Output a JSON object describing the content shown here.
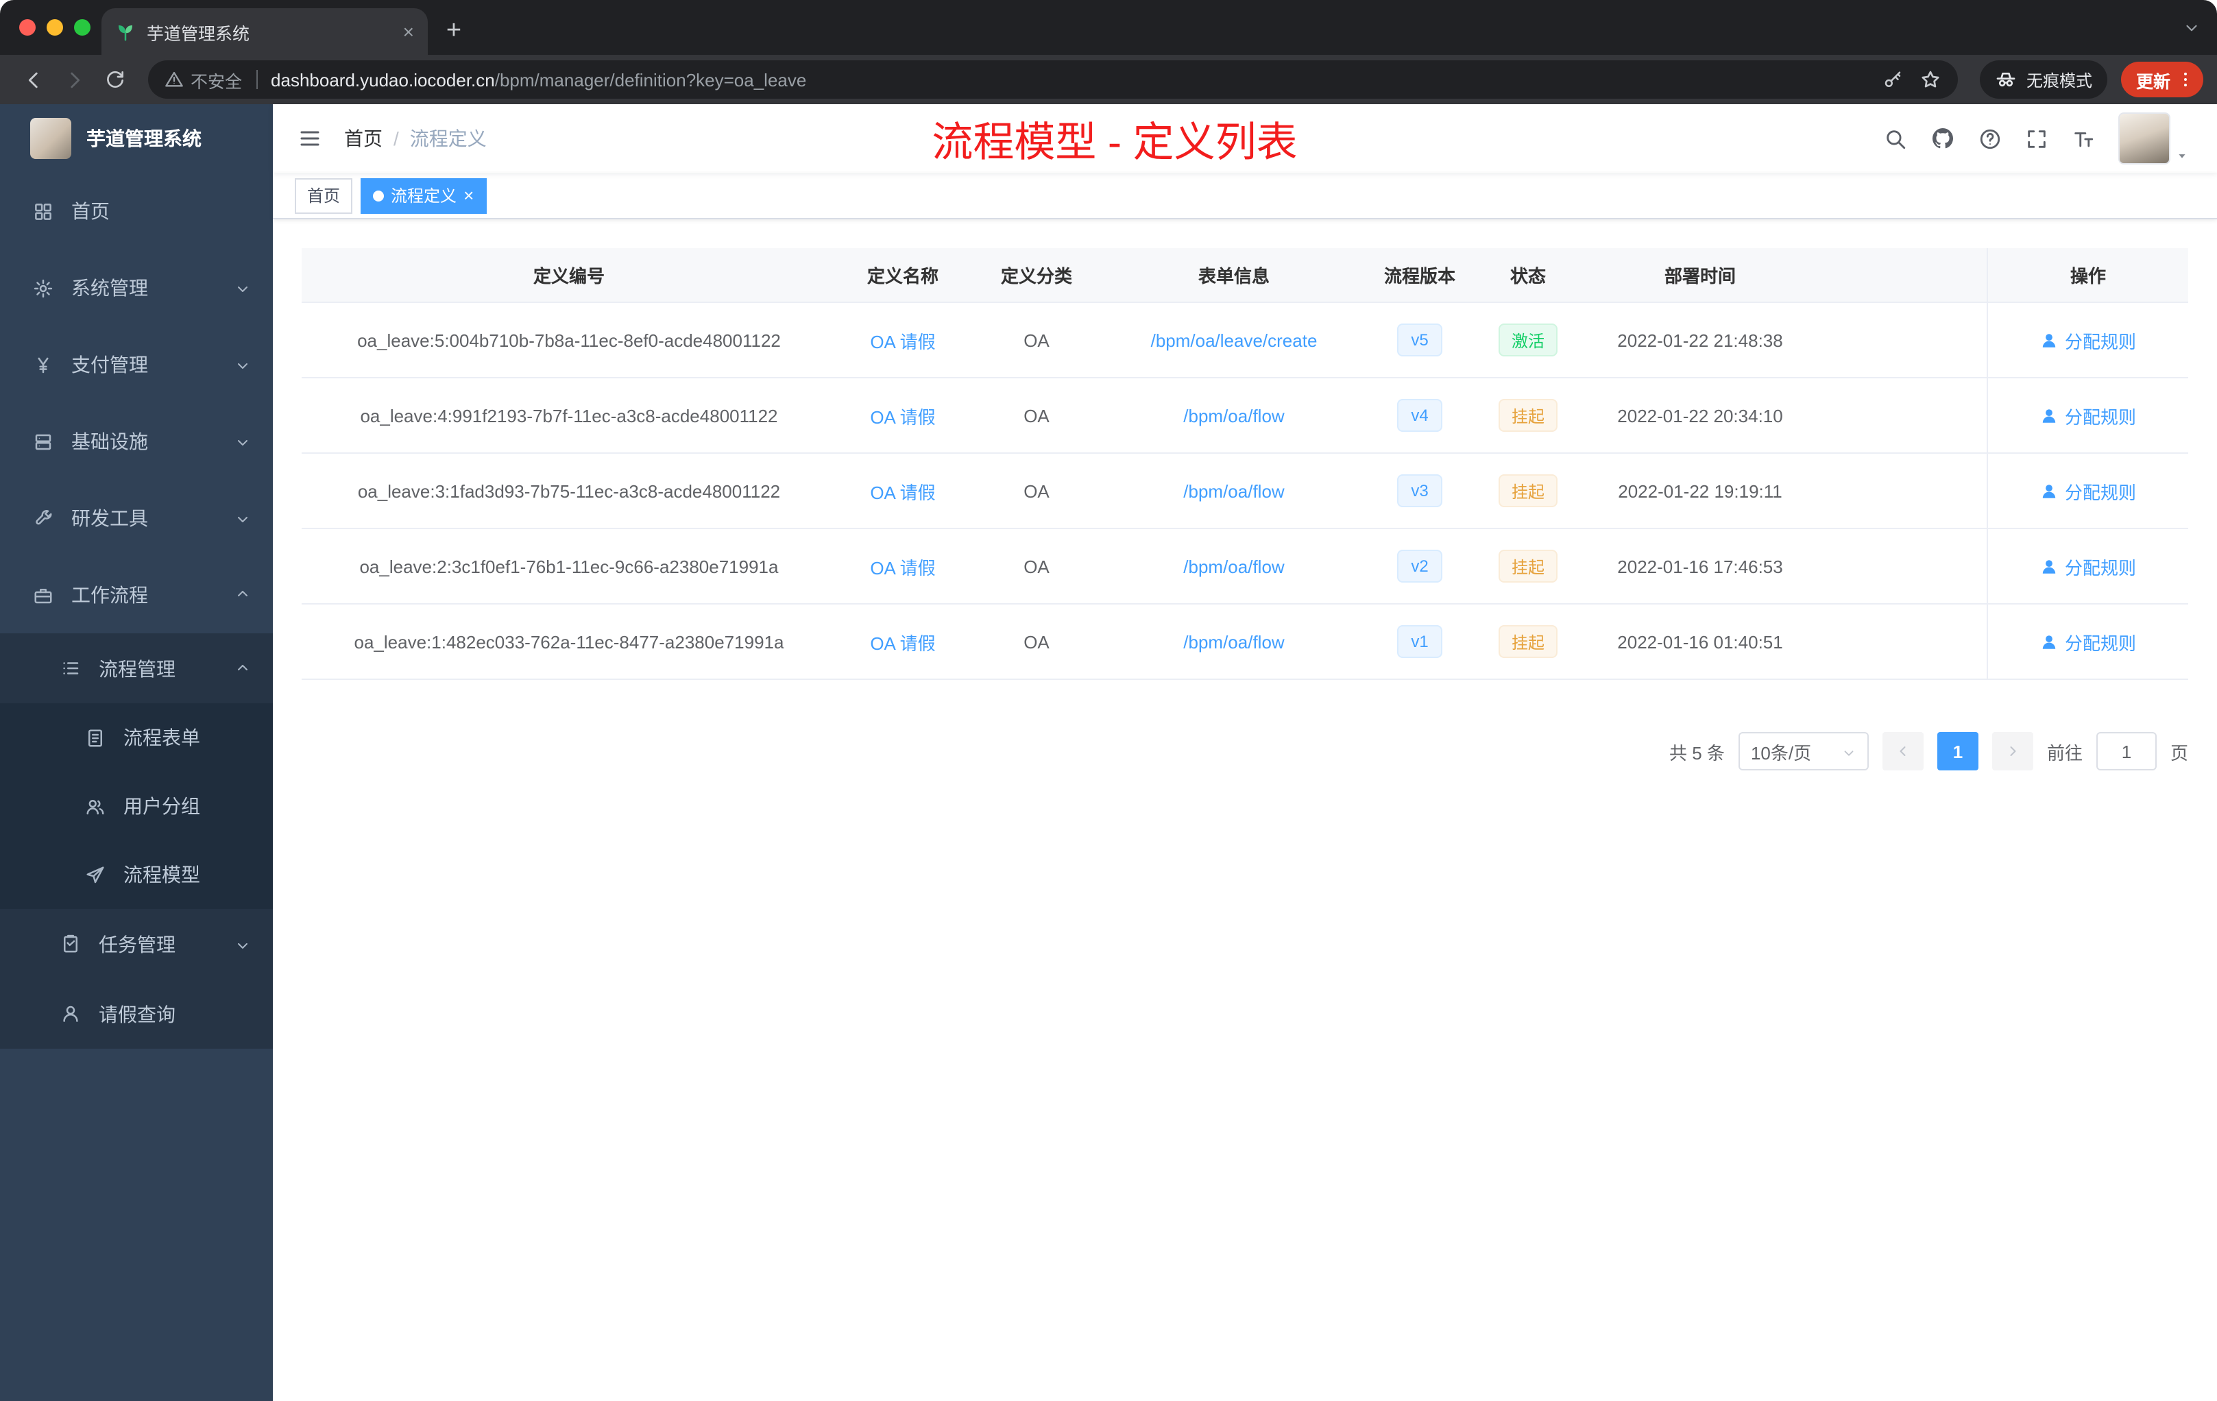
{
  "browser": {
    "tab_title": "芋道管理系统",
    "new_tab_label": "+",
    "security_label": "不安全",
    "url_host": "dashboard.yudao.iocoder.cn",
    "url_path": "/bpm/manager/definition?key=oa_leave",
    "incognito_label": "无痕模式",
    "update_label": "更新",
    "close_tab_label": "×"
  },
  "sidebar": {
    "logo_title": "芋道管理系统",
    "items": [
      {
        "label": "首页",
        "icon": "dashboard-icon"
      },
      {
        "label": "系统管理",
        "icon": "gear-icon",
        "expanded": false
      },
      {
        "label": "支付管理",
        "icon": "yen-icon",
        "expanded": false
      },
      {
        "label": "基础设施",
        "icon": "server-icon",
        "expanded": false
      },
      {
        "label": "研发工具",
        "icon": "wrench-icon",
        "expanded": false
      },
      {
        "label": "工作流程",
        "icon": "briefcase-icon",
        "expanded": true
      },
      {
        "label": "流程管理",
        "icon": "list-icon",
        "expanded": true
      },
      {
        "label": "流程表单",
        "icon": "document-icon"
      },
      {
        "label": "用户分组",
        "icon": "users-icon"
      },
      {
        "label": "流程模型",
        "icon": "paper-plane-icon"
      },
      {
        "label": "任务管理",
        "icon": "clipboard-icon",
        "expanded": false
      },
      {
        "label": "请假查询",
        "icon": "user-icon"
      }
    ]
  },
  "header": {
    "breadcrumb": {
      "home": "首页",
      "separator": "/",
      "current": "流程定义"
    },
    "annotation": "流程模型 - 定义列表"
  },
  "tags": {
    "home": "首页",
    "current": "流程定义",
    "close": "×"
  },
  "table": {
    "columns": [
      "定义编号",
      "定义名称",
      "定义分类",
      "表单信息",
      "流程版本",
      "状态",
      "部署时间",
      "操作"
    ],
    "rows": [
      {
        "id": "oa_leave:5:004b710b-7b8a-11ec-8ef0-acde48001122",
        "name": "OA 请假",
        "category": "OA",
        "form": "/bpm/oa/leave/create",
        "version": "v5",
        "status": "激活",
        "status_type": "success",
        "deploy_time": "2022-01-22 21:48:38",
        "action": "分配规则"
      },
      {
        "id": "oa_leave:4:991f2193-7b7f-11ec-a3c8-acde48001122",
        "name": "OA 请假",
        "category": "OA",
        "form": "/bpm/oa/flow",
        "version": "v4",
        "status": "挂起",
        "status_type": "warning",
        "deploy_time": "2022-01-22 20:34:10",
        "action": "分配规则"
      },
      {
        "id": "oa_leave:3:1fad3d93-7b75-11ec-a3c8-acde48001122",
        "name": "OA 请假",
        "category": "OA",
        "form": "/bpm/oa/flow",
        "version": "v3",
        "status": "挂起",
        "status_type": "warning",
        "deploy_time": "2022-01-22 19:19:11",
        "action": "分配规则"
      },
      {
        "id": "oa_leave:2:3c1f0ef1-76b1-11ec-9c66-a2380e71991a",
        "name": "OA 请假",
        "category": "OA",
        "form": "/bpm/oa/flow",
        "version": "v2",
        "status": "挂起",
        "status_type": "warning",
        "deploy_time": "2022-01-16 17:46:53",
        "action": "分配规则"
      },
      {
        "id": "oa_leave:1:482ec033-762a-11ec-8477-a2380e71991a",
        "name": "OA 请假",
        "category": "OA",
        "form": "/bpm/oa/flow",
        "version": "v1",
        "status": "挂起",
        "status_type": "warning",
        "deploy_time": "2022-01-16 01:40:51",
        "action": "分配规则"
      }
    ]
  },
  "pagination": {
    "total": "共 5 条",
    "page_size": "10条/页",
    "current_page": "1",
    "goto_label": "前往",
    "goto_value": "1",
    "goto_unit": "页"
  },
  "colors": {
    "primary": "#409eff",
    "success_text": "#13ce66",
    "warning_text": "#e6a23c",
    "annotation_red": "#f21d1d",
    "sidebar_bg": "#304156",
    "traffic_lights": [
      "#ff5f57",
      "#febc2e",
      "#28c840"
    ]
  },
  "icons": {
    "search-icon": "magnifier",
    "github-icon": "octocat",
    "help-icon": "question-circle",
    "fullscreen-icon": "expand-corners",
    "font-size-icon": "T",
    "assign-user-icon": "person",
    "incognito-icon": "spy",
    "warning-icon": "triangle-exclamation"
  }
}
